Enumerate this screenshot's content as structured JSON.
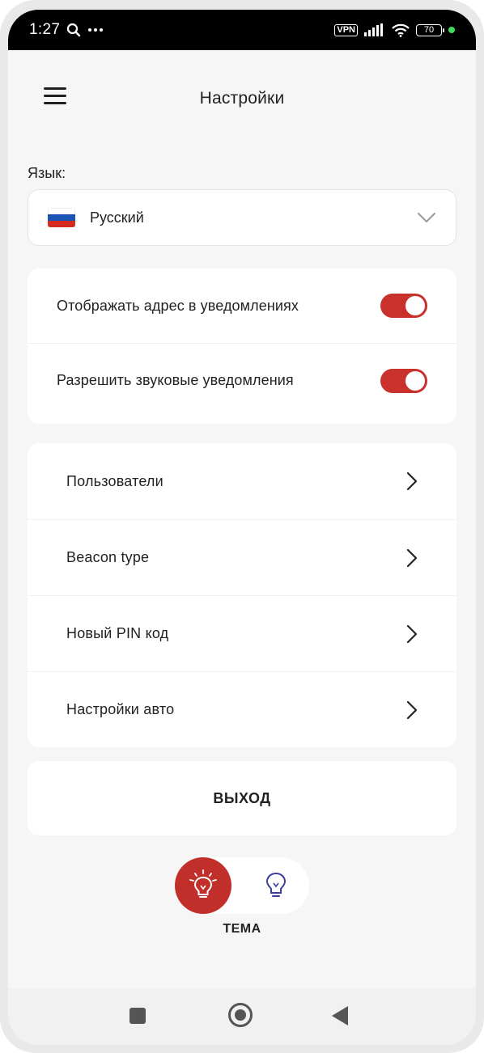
{
  "status_bar": {
    "time": "1:27",
    "vpn": "VPN",
    "battery": "70",
    "icons": [
      "search-icon",
      "more-dots-icon",
      "signal-icon",
      "wifi-icon",
      "battery-icon"
    ]
  },
  "header": {
    "title": "Настройки"
  },
  "language": {
    "label": "Язык:",
    "value": "Русский",
    "flag": "russia-flag"
  },
  "toggles": [
    {
      "label": "Отображать адрес в уведомлениях",
      "enabled": true
    },
    {
      "label": "Разрешить звуковые уведомления",
      "enabled": true
    }
  ],
  "menu": [
    {
      "label": "Пользователи"
    },
    {
      "label": "Beacon type"
    },
    {
      "label": "Новый PIN код"
    },
    {
      "label": "Настройки авто"
    }
  ],
  "logout": {
    "label": "ВЫХОД"
  },
  "theme": {
    "label": "ТЕМА",
    "selected": "light"
  },
  "colors": {
    "accent": "#c9322c",
    "background": "#f6f6f6",
    "card": "#ffffff",
    "theme_dark_icon": "#3a3f9a"
  }
}
